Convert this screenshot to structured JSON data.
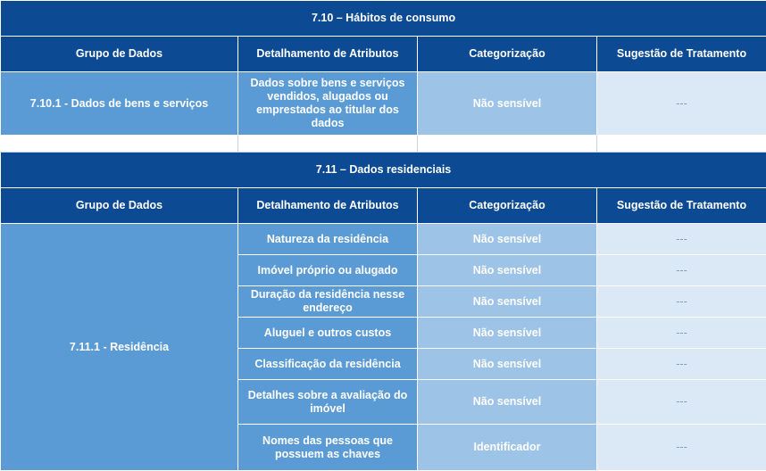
{
  "section1": {
    "title": "7.10 – Hábitos de consumo",
    "headers": [
      "Grupo de Dados",
      "Detalhamento de Atributos",
      "Categorização",
      "Sugestão de Tratamento"
    ],
    "rows": [
      {
        "group": "7.10.1 - Dados de bens e serviços",
        "detail": "Dados sobre bens e serviços vendidos, alugados ou emprestados ao titular dos dados",
        "category": "Não sensível",
        "suggestion": "---"
      }
    ]
  },
  "section2": {
    "title": "7.11 – Dados residenciais",
    "headers": [
      "Grupo de Dados",
      "Detalhamento de Atributos",
      "Categorização",
      "Sugestão de Tratamento"
    ],
    "group": "7.11.1 - Residência",
    "rows": [
      {
        "detail": "Natureza da residência",
        "category": "Não sensível",
        "suggestion": "---"
      },
      {
        "detail": "Imóvel próprio ou alugado",
        "category": "Não sensível",
        "suggestion": "---"
      },
      {
        "detail": "Duração da residência nesse endereço",
        "category": "Não sensível",
        "suggestion": "---"
      },
      {
        "detail": "Aluguel e outros custos",
        "category": "Não sensível",
        "suggestion": "---"
      },
      {
        "detail": "Classificação da residência",
        "category": "Não sensível",
        "suggestion": "---"
      },
      {
        "detail": "Detalhes sobre a avaliação do imóvel",
        "category": "Não sensível",
        "suggestion": "---"
      },
      {
        "detail": "Nomes das pessoas que possuem as chaves",
        "category": "Identificador",
        "suggestion": "---"
      }
    ]
  },
  "colors": {
    "header_blue": "#0c4a93",
    "group_blue": "#5b9bd5",
    "category_blue": "#9dc3e6",
    "suggestion_blue": "#dbe9f6"
  }
}
